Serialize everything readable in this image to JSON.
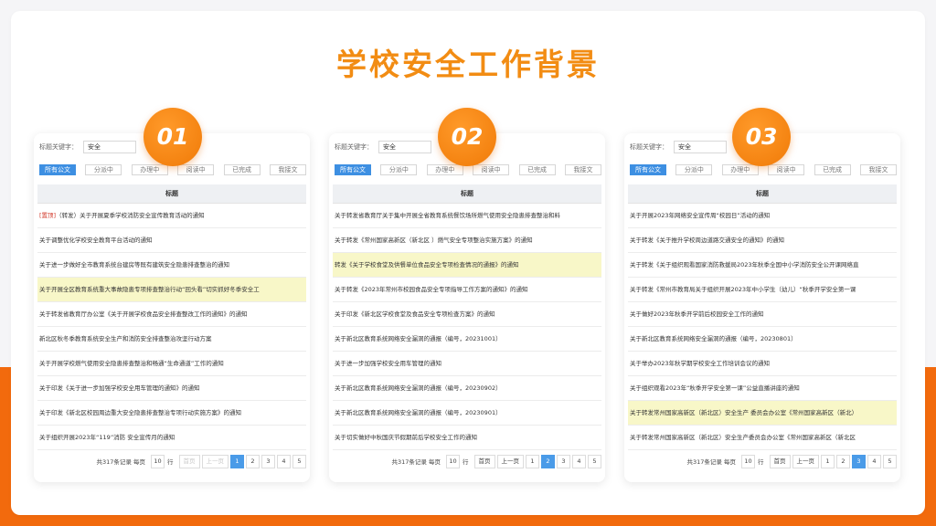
{
  "title": "学校安全工作背景",
  "panels": [
    {
      "badge": "01",
      "search_label": "标题关键字：",
      "search_value": "安全",
      "tabs": [
        "所有公文",
        "分派中",
        "办理中",
        "阅读中",
        "已完成",
        "我接文"
      ],
      "table_header": "标题",
      "rows": [
        {
          "tag": "[置顶]",
          "text": "（转发）关于开展夏季学校消防安全宣传教育活动的通知",
          "highlight": false
        },
        {
          "tag": "",
          "text": "关于调整优化学校安全教育平台活动的通知",
          "highlight": false
        },
        {
          "tag": "",
          "text": "关于进一步做好全市教育系统台建房等既有建筑安全隐患排查整治的通知",
          "highlight": false
        },
        {
          "tag": "",
          "text": "关于开展全区教育系统重大事故隐患专项排查整治行动“回头看”切实抓好冬季安全工",
          "highlight": true
        },
        {
          "tag": "",
          "text": "关于转发省教育厅办公室《关于开展学校食品安全排查整改工作的通知》的通知",
          "highlight": false
        },
        {
          "tag": "",
          "text": "新北区秋冬季教育系统安全生产和消防安全排查整治攻坚行动方案",
          "highlight": false
        },
        {
          "tag": "",
          "text": "关于开展学校燃气使用安全隐患排查整治和畅通“生命通道”工作的通知",
          "highlight": false
        },
        {
          "tag": "",
          "text": "关于印发《关于进一步加强学校安全用车管理的通知》的通知",
          "highlight": false
        },
        {
          "tag": "",
          "text": "关于印发《新北区校园周边重大安全隐患排查整治专项行动实施方案》的通知",
          "highlight": false
        },
        {
          "tag": "",
          "text": "关于组织开展2023年“119”消防 安全宣传月的通知",
          "highlight": false
        }
      ],
      "pager": {
        "total_text": "共317条记录 每页",
        "per_page": "10",
        "unit": "行",
        "first": "首页",
        "prev": "上一页",
        "pages": [
          "1",
          "2",
          "3",
          "4",
          "5"
        ],
        "current": "1"
      }
    },
    {
      "badge": "02",
      "search_label": "标题关键字：",
      "search_value": "安全",
      "tabs": [
        "所有公文",
        "分派中",
        "办理中",
        "阅读中",
        "已完成",
        "我接文"
      ],
      "table_header": "标题",
      "rows": [
        {
          "tag": "",
          "text": "关于转发省教育厅关于集中开展全省教育系统餐饮场所燃气使用安全隐患排查整治和料",
          "highlight": false
        },
        {
          "tag": "",
          "text": "关于转发《常州国家高新区（新北区 ）燃气安全专项整治实施方案》的通知",
          "highlight": false
        },
        {
          "tag": "",
          "text": "转发《关于学校食堂及供餐单位食品安全专项检查情况的通报》的通知",
          "highlight": true
        },
        {
          "tag": "",
          "text": "关于转发《2023年常州市校园食品安全专项指导工作方案的通知》的通知",
          "highlight": false
        },
        {
          "tag": "",
          "text": "关于印发《新北区学校食堂及食品安全专项检查方案》的通知",
          "highlight": false
        },
        {
          "tag": "",
          "text": "关于新北区教育系统网络安全漏洞的通报（编号，20231001）",
          "highlight": false
        },
        {
          "tag": "",
          "text": "关于进一步加强学校安全用车管理的通知",
          "highlight": false
        },
        {
          "tag": "",
          "text": "关于新北区教育系统网络安全漏洞的通报（编号，20230902）",
          "highlight": false
        },
        {
          "tag": "",
          "text": "关于新北区教育系统网络安全漏洞的通报（编号，20230901）",
          "highlight": false
        },
        {
          "tag": "",
          "text": "关于切实做好中秋国庆节假期前后学校安全工作的通知",
          "highlight": false
        }
      ],
      "pager": {
        "total_text": "共317条记录 每页",
        "per_page": "10",
        "unit": "行",
        "first": "首页",
        "prev": "上一页",
        "pages": [
          "1",
          "2",
          "3",
          "4",
          "5"
        ],
        "current": "2"
      }
    },
    {
      "badge": "03",
      "search_label": "标题关键字：",
      "search_value": "安全",
      "tabs": [
        "所有公文",
        "分派中",
        "办理中",
        "阅读中",
        "已完成",
        "我接文"
      ],
      "table_header": "标题",
      "rows": [
        {
          "tag": "",
          "text": "关于开展2023年网络安全宣传周“校园日”活动的通知",
          "highlight": false
        },
        {
          "tag": "",
          "text": "关于转发《关于推升学校周边道路交通安全的通知》的通知",
          "highlight": false
        },
        {
          "tag": "",
          "text": "关于转发《关于组织观看国家消防救援局2023年秋季全国中小学消防安全公开课网络直",
          "highlight": false
        },
        {
          "tag": "",
          "text": "关于转发《常州市教育局关于组织开展2023年中小学生（幼儿）“秋季开学安全第一课",
          "highlight": false
        },
        {
          "tag": "",
          "text": "关于做好2023年秋季开学前后校园安全工作的通知",
          "highlight": false
        },
        {
          "tag": "",
          "text": "关于新北区教育系统网络安全漏洞的通报（编号，20230801）",
          "highlight": false
        },
        {
          "tag": "",
          "text": "关于举办2023年秋学期学校安全工作培训会议的通知",
          "highlight": false
        },
        {
          "tag": "",
          "text": "关于组织观看2023年“秋季开学安全第一课”公益直播讲座的通知",
          "highlight": false
        },
        {
          "tag": "",
          "text": "关于转发常州国家高新区（新北区）安全生产 委员会办公室《常州国家高新区（新北）",
          "highlight": true
        },
        {
          "tag": "",
          "text": "关于转发常州国家高新区（新北区）安全生产委员会办公室《常州国家高新区（新北区",
          "highlight": false
        }
      ],
      "pager": {
        "total_text": "共317条记录 每页",
        "per_page": "10",
        "unit": "行",
        "first": "首页",
        "prev": "上一页",
        "pages": [
          "1",
          "2",
          "3",
          "4",
          "5"
        ],
        "current": "3"
      }
    }
  ],
  "colors": {
    "accent": "#f28c13",
    "bottom_band": "#f26a0d",
    "tab_active": "#3d8fe2",
    "highlight_row": "#f8f7c8",
    "pin_tag": "#d23a2b"
  }
}
